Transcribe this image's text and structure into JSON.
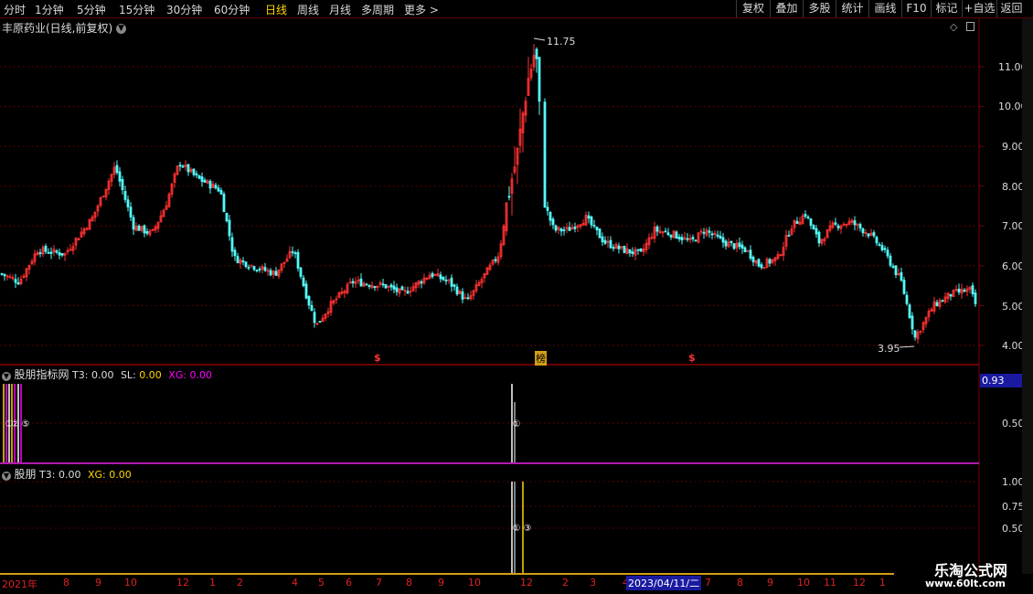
{
  "toolbar": {
    "timeframes": [
      "分时",
      "1分钟",
      "5分钟",
      "15分钟",
      "30分钟",
      "60分钟",
      "日线",
      "周线",
      "月线",
      "多周期",
      "更多 >"
    ],
    "active": "日线",
    "right_buttons": [
      "复权",
      "叠加",
      "多股",
      "统计",
      "画线",
      "F10",
      "标记",
      "+自选",
      "返回"
    ]
  },
  "main_chart": {
    "title": "丰原药业(日线,前复权)",
    "high_label": "11.75",
    "low_label": "3.95",
    "price_axis": [
      "11.00",
      "10.00",
      "9.00",
      "8.00",
      "7.00",
      "6.00",
      "5.00",
      "4.00"
    ],
    "markers": [
      "$",
      "榜",
      "$"
    ]
  },
  "indicator1": {
    "name": "股朋指标网",
    "t3_label": "T3:",
    "t3_value": "0.00",
    "sl_label": "SL:",
    "sl_value": "0.00",
    "xg_label": "XG:",
    "xg_value": "0.00",
    "current_value": "0.93",
    "axis": [
      "0.50"
    ]
  },
  "indicator2": {
    "name": "股朋",
    "t3_label": "T3:",
    "t3_value": "0.00",
    "xg_label": "XG:",
    "xg_value": "0.00",
    "axis": [
      "1.00",
      "0.75",
      "0.50"
    ]
  },
  "date_axis": {
    "labels": [
      "2021年",
      "8",
      "9",
      "10",
      "12",
      "1",
      "2",
      "4",
      "5",
      "6",
      "7",
      "8",
      "9",
      "10",
      "12",
      "2",
      "3",
      "4",
      "7",
      "8",
      "9",
      "10",
      "11",
      "12",
      "1"
    ],
    "cursor_date": "2023/04/11/二"
  },
  "watermark": {
    "line1": "乐淘公式网",
    "line2": "www.60lt.com"
  },
  "colors": {
    "up": "#ff3232",
    "down": "#54fcfc",
    "background": "#000000",
    "grid": "#5a0000",
    "accent_yellow": "#ffd700",
    "magenta": "#ff00ff"
  }
}
